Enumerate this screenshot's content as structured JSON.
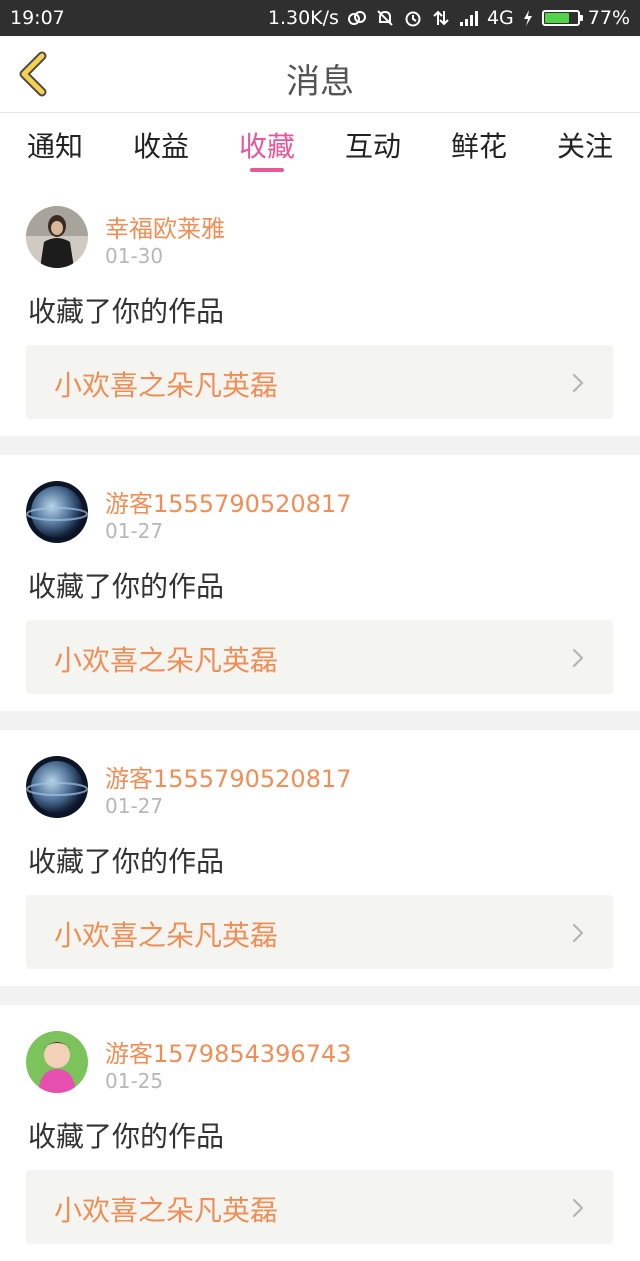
{
  "status_bar": {
    "time": "19:07",
    "net_speed": "1.30K/s",
    "network": "4G",
    "battery_pct_text": "77%",
    "battery_level": 0.77,
    "battery_color": "#51d34a"
  },
  "header": {
    "title": "消息",
    "back_icon": "chevron-left-icon",
    "accent": "#f5d24a"
  },
  "tabs": [
    {
      "label": "通知"
    },
    {
      "label": "收益"
    },
    {
      "label": "收藏",
      "active": true
    },
    {
      "label": "互动"
    },
    {
      "label": "鲜花"
    },
    {
      "label": "关注"
    }
  ],
  "feed": [
    {
      "name": "幸福欧莱雅",
      "date": "01-30",
      "action": "收藏了你的作品",
      "work": "小欢喜之朵凡英磊",
      "avatar": "woman-photo"
    },
    {
      "name": "游客1555790520817",
      "date": "01-27",
      "action": "收藏了你的作品",
      "work": "小欢喜之朵凡英磊",
      "avatar": "planet-photo"
    },
    {
      "name": "游客1555790520817",
      "date": "01-27",
      "action": "收藏了你的作品",
      "work": "小欢喜之朵凡英磊",
      "avatar": "planet-photo"
    },
    {
      "name": "游客1579854396743",
      "date": "01-25",
      "action": "收藏了你的作品",
      "work": "小欢喜之朵凡英磊",
      "avatar": "baby-photo"
    }
  ],
  "colors": {
    "active_tab": "#e9579b",
    "username": "#ef8f57",
    "date": "#b7b7b7"
  }
}
